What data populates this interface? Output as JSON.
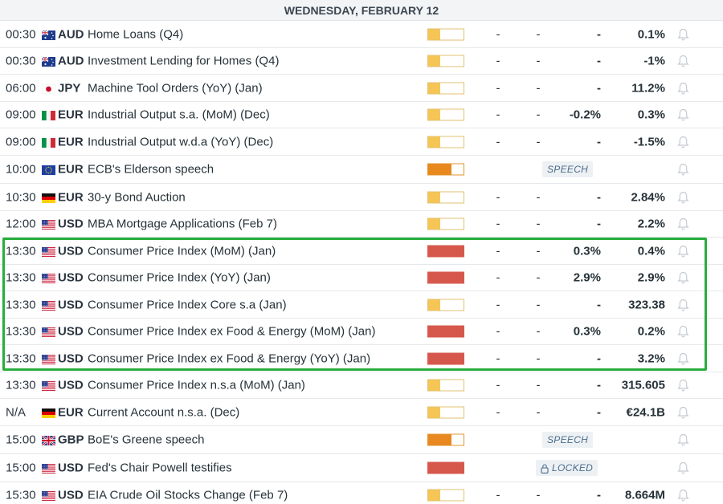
{
  "calendar": {
    "day_header": "WEDNESDAY, FEBRUARY 12",
    "rows": [
      {
        "time": "00:30",
        "flag": "au",
        "currency": "AUD",
        "event": "Home Loans (Q4)",
        "impact": "low",
        "c1": "-",
        "c2": "-",
        "c3": "-",
        "c4": "0.1%"
      },
      {
        "time": "00:30",
        "flag": "au",
        "currency": "AUD",
        "event": "Investment Lending for Homes (Q4)",
        "impact": "low",
        "c1": "-",
        "c2": "-",
        "c3": "-",
        "c4": "-1%"
      },
      {
        "time": "06:00",
        "flag": "jp",
        "currency": "JPY",
        "event": "Machine Tool Orders (YoY) (Jan)",
        "impact": "low",
        "c1": "-",
        "c2": "-",
        "c3": "-",
        "c4": "11.2%"
      },
      {
        "time": "09:00",
        "flag": "it",
        "currency": "EUR",
        "event": "Industrial Output s.a. (MoM) (Dec)",
        "impact": "low",
        "c1": "-",
        "c2": "-",
        "c3": "-0.2%",
        "c4": "0.3%"
      },
      {
        "time": "09:00",
        "flag": "it",
        "currency": "EUR",
        "event": "Industrial Output w.d.a (YoY) (Dec)",
        "impact": "low",
        "c1": "-",
        "c2": "-",
        "c3": "-",
        "c4": "-1.5%"
      },
      {
        "time": "10:00",
        "flag": "eu",
        "currency": "EUR",
        "event": "ECB's Elderson speech",
        "impact": "medium",
        "tag": "SPEECH"
      },
      {
        "time": "10:30",
        "flag": "de",
        "currency": "EUR",
        "event": "30-y Bond Auction",
        "impact": "low",
        "c1": "-",
        "c2": "-",
        "c3": "-",
        "c4": "2.84%"
      },
      {
        "time": "12:00",
        "flag": "us",
        "currency": "USD",
        "event": "MBA Mortgage Applications (Feb 7)",
        "impact": "low",
        "c1": "-",
        "c2": "-",
        "c3": "-",
        "c4": "2.2%"
      },
      {
        "time": "13:30",
        "flag": "us",
        "currency": "USD",
        "event": "Consumer Price Index (MoM) (Jan)",
        "impact": "high",
        "c1": "-",
        "c2": "-",
        "c3": "0.3%",
        "c4": "0.4%"
      },
      {
        "time": "13:30",
        "flag": "us",
        "currency": "USD",
        "event": "Consumer Price Index (YoY) (Jan)",
        "impact": "high",
        "c1": "-",
        "c2": "-",
        "c3": "2.9%",
        "c4": "2.9%"
      },
      {
        "time": "13:30",
        "flag": "us",
        "currency": "USD",
        "event": "Consumer Price Index Core s.a (Jan)",
        "impact": "low",
        "c1": "-",
        "c2": "-",
        "c3": "-",
        "c4": "323.38"
      },
      {
        "time": "13:30",
        "flag": "us",
        "currency": "USD",
        "event": "Consumer Price Index ex Food & Energy (MoM) (Jan)",
        "impact": "high",
        "c1": "-",
        "c2": "-",
        "c3": "0.3%",
        "c4": "0.2%"
      },
      {
        "time": "13:30",
        "flag": "us",
        "currency": "USD",
        "event": "Consumer Price Index ex Food & Energy (YoY) (Jan)",
        "impact": "high",
        "c1": "-",
        "c2": "-",
        "c3": "-",
        "c4": "3.2%"
      },
      {
        "time": "13:30",
        "flag": "us",
        "currency": "USD",
        "event": "Consumer Price Index n.s.a (MoM) (Jan)",
        "impact": "low",
        "c1": "-",
        "c2": "-",
        "c3": "-",
        "c4": "315.605"
      },
      {
        "time": "N/A",
        "flag": "de",
        "currency": "EUR",
        "event": "Current Account n.s.a. (Dec)",
        "impact": "low",
        "c1": "-",
        "c2": "-",
        "c3": "-",
        "c4": "€24.1B"
      },
      {
        "time": "15:00",
        "flag": "gb",
        "currency": "GBP",
        "event": "BoE's Greene speech",
        "impact": "medium",
        "tag": "SPEECH"
      },
      {
        "time": "15:00",
        "flag": "us",
        "currency": "USD",
        "event": "Fed's Chair Powell testifies",
        "impact": "high",
        "tag": "LOCKED"
      },
      {
        "time": "15:30",
        "flag": "us",
        "currency": "USD",
        "event": "EIA Crude Oil Stocks Change (Feb 7)",
        "impact": "low",
        "c1": "-",
        "c2": "-",
        "c3": "-",
        "c4": "8.664M"
      }
    ]
  },
  "colors": {
    "impact_low": "#f5c655",
    "impact_medium": "#e8881f",
    "impact_high": "#d6584d",
    "highlight_border": "#27ad3c"
  },
  "icons": {
    "alert": "bell-icon",
    "locked": "lock-icon"
  }
}
